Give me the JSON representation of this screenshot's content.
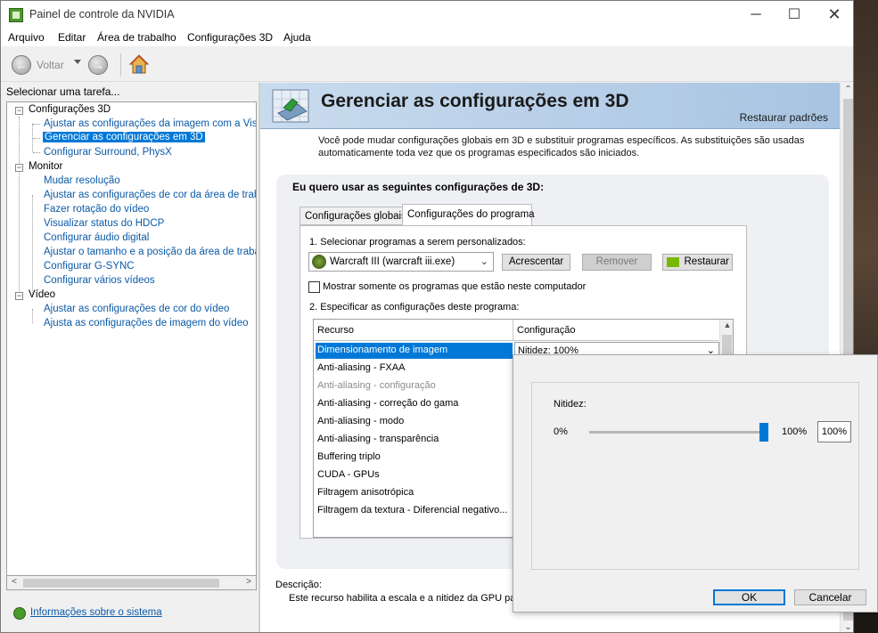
{
  "window": {
    "title": "Painel de controle da NVIDIA",
    "min_glyph": "─",
    "max_glyph": "☐",
    "close_glyph": "✕"
  },
  "menu": [
    "Arquivo",
    "Editar",
    "Área de trabalho",
    "Configurações 3D",
    "Ajuda"
  ],
  "toolbar": {
    "back_label": "Voltar",
    "back_glyph": "←",
    "forward_glyph": "→"
  },
  "sidebar": {
    "task_header": "Selecionar uma tarefa...",
    "groups": [
      {
        "label": "Configurações 3D",
        "toggle": "−",
        "items": [
          "Ajustar as configurações da imagem com a Visuali:",
          "Gerenciar as configurações em 3D",
          "Configurar Surround, PhysX"
        ]
      },
      {
        "label": "Monitor",
        "toggle": "−",
        "items": [
          "Mudar resolução",
          "Ajustar as configurações de cor da área de trabal",
          "Fazer rotação do vídeo",
          "Visualizar status do HDCP",
          "Configurar áudio digital",
          "Ajustar o tamanho e a posição da área de trabalh",
          "Configurar G-SYNC",
          "Configurar vários vídeos"
        ]
      },
      {
        "label": "Vídeo",
        "toggle": "−",
        "items": [
          "Ajustar as configurações de cor do vídeo",
          "Ajusta as configurações de imagem do vídeo"
        ]
      }
    ],
    "selected_item": "Gerenciar as configurações em 3D",
    "system_info_link": "Informações sobre o sistema",
    "scroll_left": "<",
    "scroll_right": ">"
  },
  "main": {
    "title": "Gerenciar as configurações em 3D",
    "restore_defaults": "Restaurar padrões",
    "intro": "Você pode mudar configurações globais em 3D e substituir programas específicos. As substituições são usadas automaticamente toda vez que os programas especificados são iniciados.",
    "settings_label": "Eu quero usar as seguintes configurações de 3D:",
    "tabs": [
      "Configurações globais",
      "Configurações do programa"
    ],
    "active_tab": "Configurações do programa",
    "step1_label": "1. Selecionar programas a serem personalizados:",
    "selected_program": "Warcraft III (warcraft iii.exe)",
    "add_button": "Acrescentar",
    "remove_button": "Remover",
    "restore_button": "Restaurar",
    "show_only_checkbox": "Mostrar somente os programas que estão neste computador",
    "show_only_checked": false,
    "step2_label": "2. Especificar as configurações deste programa:",
    "columns": [
      "Recurso",
      "Configuração"
    ],
    "rows": [
      {
        "feature": "Dimensionamento de imagem",
        "setting": "Nitidez: 100%",
        "selected": true,
        "disabled": false
      },
      {
        "feature": "Anti-aliasing - FXAA",
        "setting": "",
        "selected": false,
        "disabled": false
      },
      {
        "feature": "Anti-aliasing - configuração",
        "setting": "",
        "selected": false,
        "disabled": true
      },
      {
        "feature": "Anti-aliasing - correção do gama",
        "setting": "",
        "selected": false,
        "disabled": false
      },
      {
        "feature": "Anti-aliasing - modo",
        "setting": "",
        "selected": false,
        "disabled": false
      },
      {
        "feature": "Anti-aliasing - transparência",
        "setting": "",
        "selected": false,
        "disabled": false
      },
      {
        "feature": "Buffering triplo",
        "setting": "",
        "selected": false,
        "disabled": false
      },
      {
        "feature": "CUDA - GPUs",
        "setting": "",
        "selected": false,
        "disabled": false
      },
      {
        "feature": "Filtragem anisotrópica",
        "setting": "",
        "selected": false,
        "disabled": false
      },
      {
        "feature": "Filtragem da textura - Diferencial negativo...",
        "setting": "",
        "selected": false,
        "disabled": false
      }
    ],
    "description_label": "Descrição:",
    "description_text": "Este recurso habilita a escala e a nitidez da GPU para"
  },
  "popup": {
    "sharpness_label": "Nitidez:",
    "min_label": "0%",
    "max_label": "100%",
    "value_text": "100%",
    "value": 1.0,
    "ok_button": "OK",
    "cancel_button": "Cancelar"
  },
  "colors": {
    "accent": "#0078d7",
    "link": "#0b5aa8",
    "nvidia_green": "#76b900",
    "banner": "#a8c4e2"
  }
}
